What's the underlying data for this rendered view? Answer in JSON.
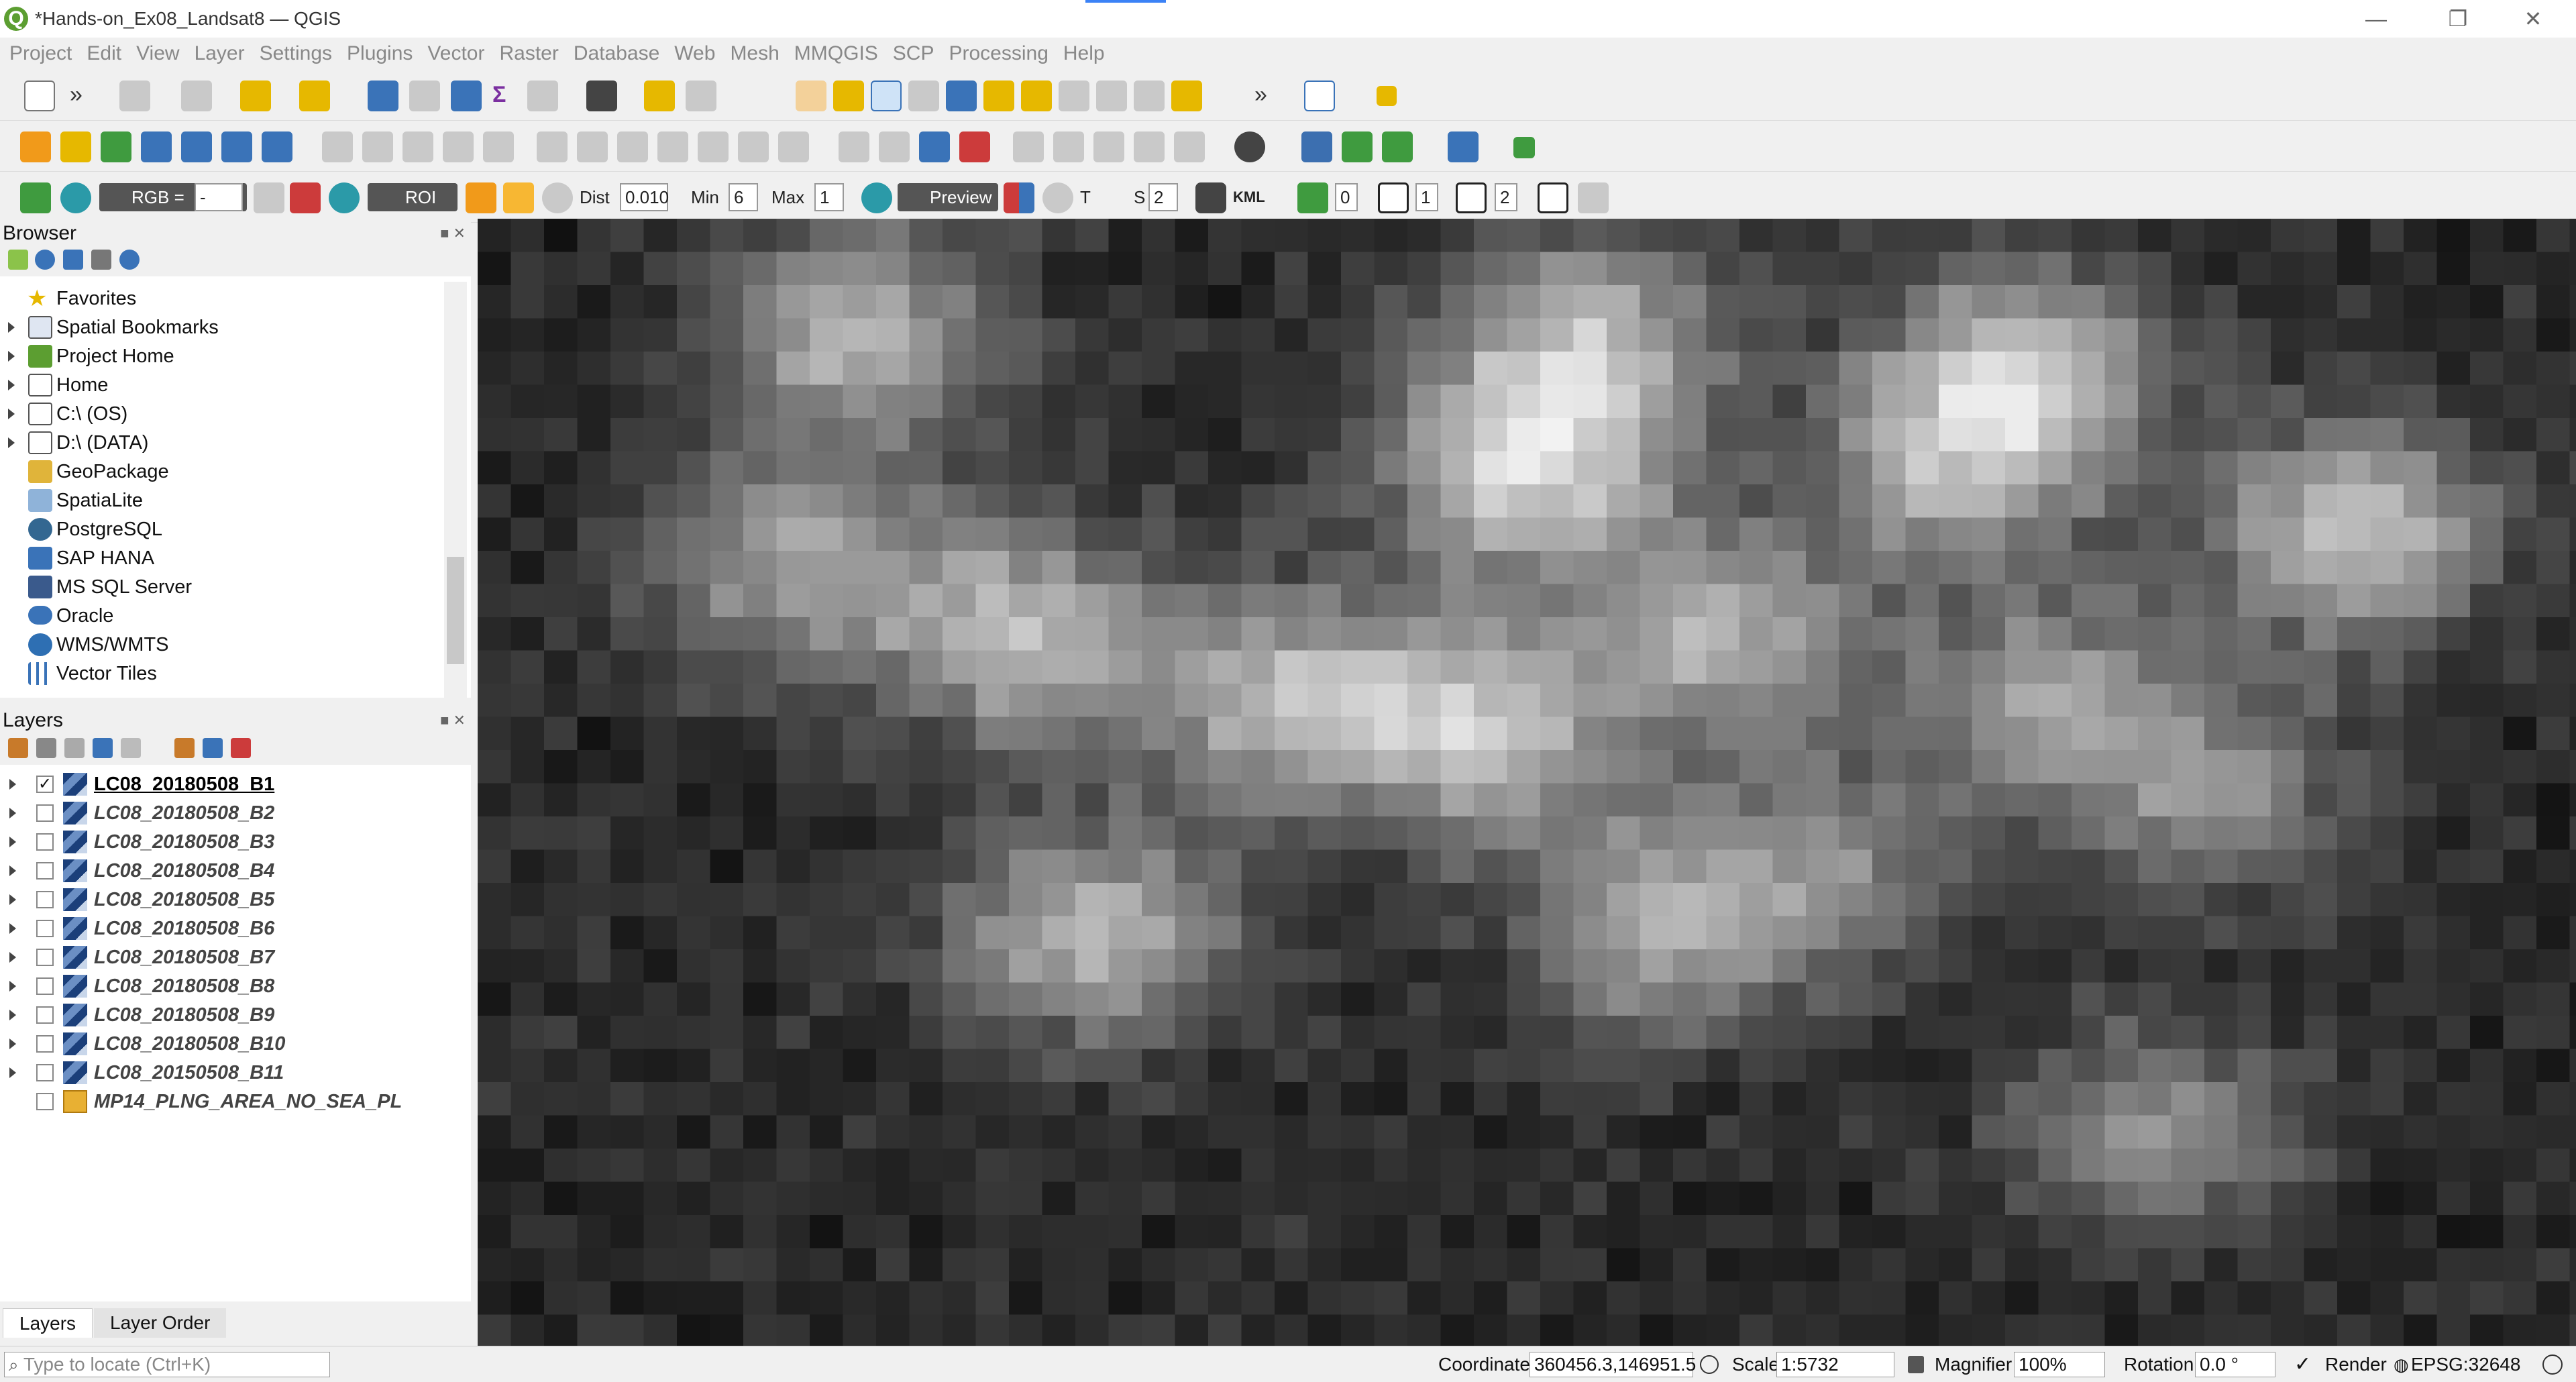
{
  "window": {
    "title": "*Hands-on_Ex08_Landsat8 — QGIS",
    "logo": "Q",
    "minimize": "—",
    "restore": "❐",
    "close": "✕"
  },
  "menu": [
    "Project",
    "Edit",
    "View",
    "Layer",
    "Settings",
    "Plugins",
    "Vector",
    "Raster",
    "Database",
    "Web",
    "Mesh",
    "MMQGIS",
    "SCP",
    "Processing",
    "Help"
  ],
  "scp_toolbar": {
    "rgb_label": "RGB =",
    "rgb_value": "-",
    "roi_label": "ROI",
    "dist_label": "Dist",
    "dist_value": "0.010",
    "min_label": "Min",
    "min_value": "6",
    "max_label": "Max",
    "max_value": "1",
    "preview_label": "Preview",
    "t_label": "T",
    "s_label": "S",
    "s_value": "2",
    "kml_label": "KML",
    "val0": "0",
    "val1": "1",
    "val2": "2"
  },
  "browser": {
    "title": "Browser",
    "items": [
      "Favorites",
      "Spatial Bookmarks",
      "Project Home",
      "Home",
      "C:\\ (OS)",
      "D:\\ (DATA)",
      "GeoPackage",
      "SpatiaLite",
      "PostgreSQL",
      "SAP HANA",
      "MS SQL Server",
      "Oracle",
      "WMS/WMTS",
      "Vector Tiles"
    ]
  },
  "layers": {
    "title": "Layers",
    "items": [
      {
        "name": "LC08_20180508_B1",
        "checked": true
      },
      {
        "name": "LC08_20180508_B2",
        "checked": false
      },
      {
        "name": "LC08_20180508_B3",
        "checked": false
      },
      {
        "name": "LC08_20180508_B4",
        "checked": false
      },
      {
        "name": "LC08_20180508_B5",
        "checked": false
      },
      {
        "name": "LC08_20180508_B6",
        "checked": false
      },
      {
        "name": "LC08_20180508_B7",
        "checked": false
      },
      {
        "name": "LC08_20180508_B8",
        "checked": false
      },
      {
        "name": "LC08_20180508_B9",
        "checked": false
      },
      {
        "name": "LC08_20180508_B10",
        "checked": false
      },
      {
        "name": "LC08_20150508_B11",
        "checked": false
      },
      {
        "name": "MP14_PLNG_AREA_NO_SEA_PL",
        "checked": false
      }
    ]
  },
  "tabs": {
    "layers": "Layers",
    "layer_order": "Layer Order"
  },
  "locator": {
    "placeholder": "Type to locate (Ctrl+K)"
  },
  "status": {
    "coordinate_label": "Coordinate",
    "coordinate_value": "360456.3,146951.5",
    "scale_label": "Scale",
    "scale_value": "1:5732",
    "magnifier_label": "Magnifier",
    "magnifier_value": "100%",
    "rotation_label": "Rotation",
    "rotation_value": "0.0 °",
    "render_label": "Render",
    "crs": "EPSG:32648"
  }
}
